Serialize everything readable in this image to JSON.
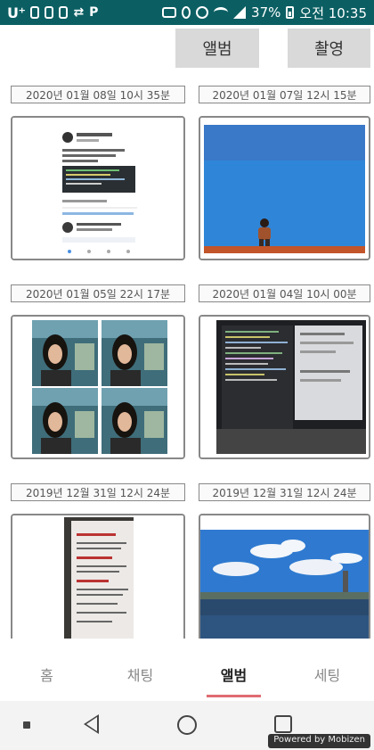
{
  "status_bar": {
    "carrier": "U⁺",
    "time": "오전 10:35",
    "battery": "37%"
  },
  "top_buttons": {
    "album": "앨범",
    "shoot": "촬영"
  },
  "photos": [
    {
      "date": "2020년 01월 08일 10시 35분",
      "desc": "tweet-screenshot"
    },
    {
      "date": "2020년 01월 07일 12시 15분",
      "desc": "sky-person"
    },
    {
      "date": "2020년 01월 05일 22시 17분",
      "desc": "four-selfies"
    },
    {
      "date": "2020년 01월 04일 10시 00분",
      "desc": "laptop-code"
    },
    {
      "date": "2019년 12월 31일 12시 24분",
      "desc": "book-page"
    },
    {
      "date": "2019년 12월 31일 12시 24분",
      "desc": "city-sky"
    }
  ],
  "tabs": [
    {
      "label": "홈",
      "active": false
    },
    {
      "label": "채팅",
      "active": false
    },
    {
      "label": "앨범",
      "active": true
    },
    {
      "label": "세팅",
      "active": false
    }
  ],
  "watermark": "Powered by Mobizen",
  "colors": {
    "status_bar": "#0b5f63",
    "accent": "#e06b73",
    "button_bg": "#d9d9d9"
  }
}
